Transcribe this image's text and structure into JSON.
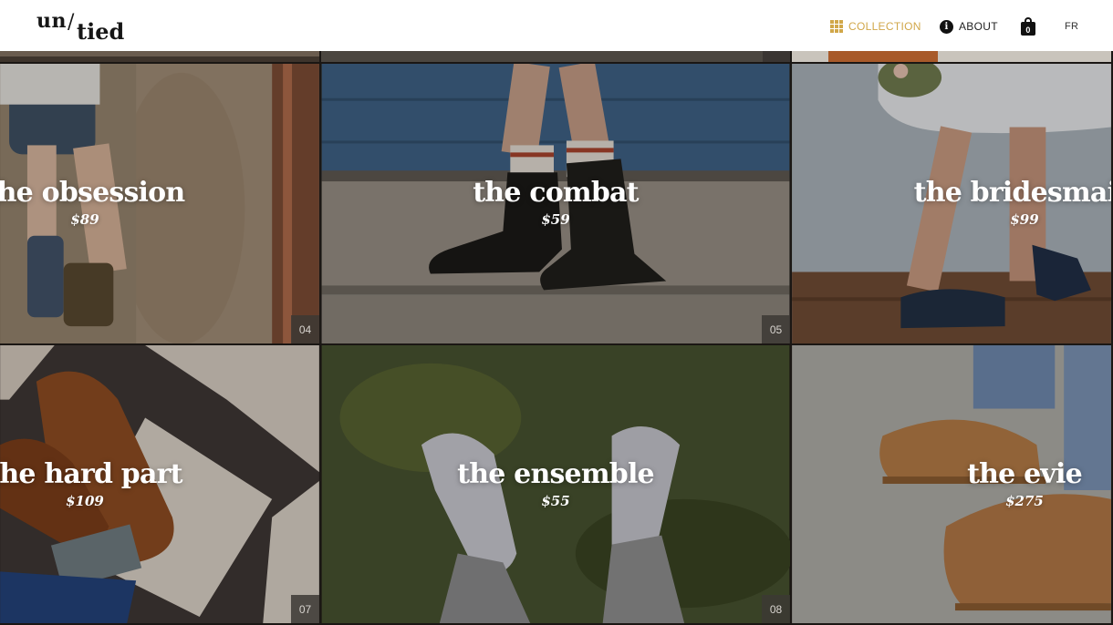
{
  "header": {
    "logo_un": "un",
    "logo_slash": "/",
    "logo_tied": "tied",
    "nav": {
      "collection": "COLLECTION",
      "about": "ABOUT",
      "cart_count": "0",
      "lang": "FR"
    },
    "accent_color": "#d1a74a"
  },
  "products": [
    {
      "title": "the obsession",
      "price": "$89",
      "number": "04"
    },
    {
      "title": "the combat",
      "price": "$59",
      "number": "05"
    },
    {
      "title": "the bridesmaid",
      "price": "$99",
      "number": ""
    },
    {
      "title": "the hard part",
      "price": "$109",
      "number": "07"
    },
    {
      "title": "the ensemble",
      "price": "$55",
      "number": "08"
    },
    {
      "title": "the evie",
      "price": "$275",
      "number": ""
    }
  ],
  "icons": {
    "collection": "grid-icon",
    "about": "info-icon",
    "cart": "shopping-bag-icon"
  }
}
